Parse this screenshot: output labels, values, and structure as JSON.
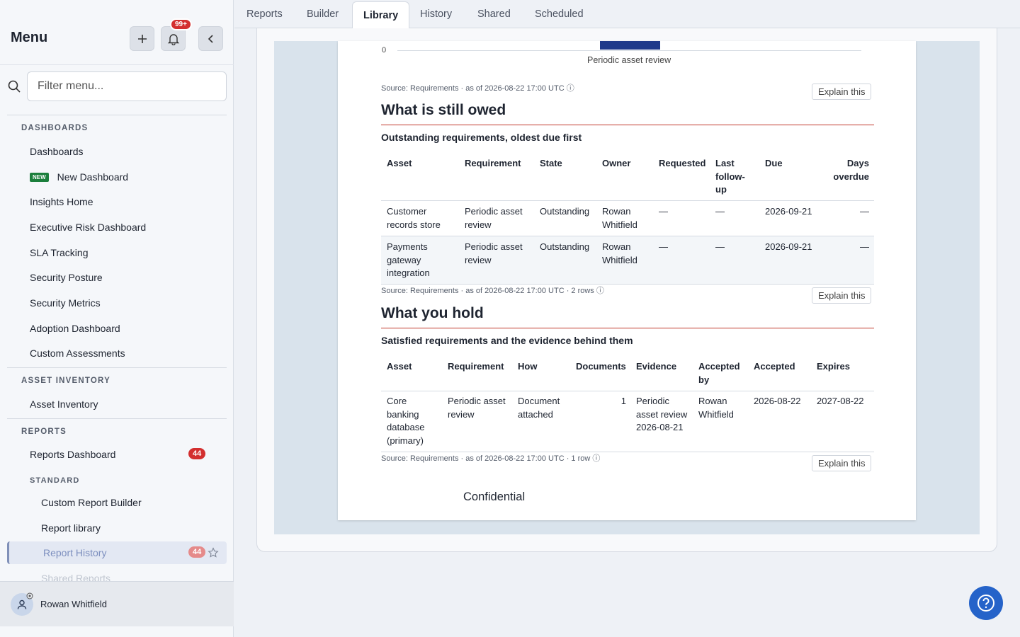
{
  "sidebar": {
    "title": "Menu",
    "notifications_badge": "99+",
    "search_placeholder": "Filter menu...",
    "sections": {
      "dashboards": "DASHBOARDS",
      "asset_inventory": "ASSET INVENTORY",
      "reports": "REPORTS",
      "standard": "STANDARD"
    },
    "items": {
      "dashboards": "Dashboards",
      "new_tag": "NEW",
      "new_dashboard": "New Dashboard",
      "insights_home": "Insights Home",
      "executive_risk": "Executive Risk Dashboard",
      "sla_tracking": "SLA Tracking",
      "security_posture": "Security Posture",
      "security_metrics": "Security Metrics",
      "adoption_dashboard": "Adoption Dashboard",
      "custom_assessments": "Custom Assessments",
      "asset_inventory": "Asset Inventory",
      "reports_dashboard": "Reports Dashboard",
      "reports_dashboard_count": "44",
      "custom_report_builder": "Custom Report Builder",
      "report_library": "Report library",
      "report_history": "Report History",
      "report_history_count": "44",
      "shared_reports": "Shared Reports"
    },
    "user": "Rowan Whitfield"
  },
  "tabs": [
    "Reports",
    "Builder",
    "Library",
    "History",
    "Shared",
    "Scheduled"
  ],
  "active_tab": "Library",
  "report": {
    "chart_fragment": {
      "zero_tick": "0",
      "category": "Periodic asset review"
    },
    "source_1": "Source: Requirements · as of 2026-08-22 17:00 UTC",
    "explain": "Explain this",
    "owed": {
      "title": "What is still owed",
      "subtitle": "Outstanding requirements, oldest due first",
      "headers": [
        "Asset",
        "Requirement",
        "State",
        "Owner",
        "Requested",
        "Last follow-up",
        "Due",
        "Days overdue"
      ],
      "rows": [
        [
          "Customer records store",
          "Periodic asset review",
          "Outstanding",
          "Rowan Whitfield",
          "—",
          "—",
          "2026-09-21",
          "—"
        ],
        [
          "Payments gateway integration",
          "Periodic asset review",
          "Outstanding",
          "Rowan Whitfield",
          "—",
          "—",
          "2026-09-21",
          "—"
        ]
      ],
      "source": "Source: Requirements · as of 2026-08-22 17:00 UTC · 2 rows"
    },
    "hold": {
      "title": "What you hold",
      "subtitle": "Satisfied requirements and the evidence behind them",
      "headers": [
        "Asset",
        "Requirement",
        "How",
        "Documents",
        "Evidence",
        "Accepted by",
        "Accepted",
        "Expires"
      ],
      "rows": [
        [
          "Core banking database (primary)",
          "Periodic asset review",
          "Document attached",
          "1",
          "Periodic asset review 2026-08-21",
          "Rowan Whitfield",
          "2026-08-22",
          "2027-08-22"
        ]
      ],
      "source": "Source: Requirements · as of 2026-08-22 17:00 UTC · 1 row"
    },
    "footer": "Confidential"
  }
}
